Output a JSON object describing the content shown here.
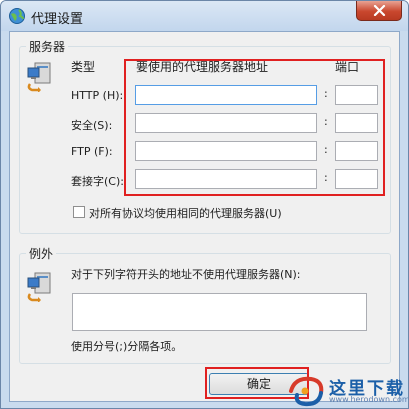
{
  "window": {
    "title": "代理设置",
    "accent": "#c9dbee",
    "close_color": "#c9472e"
  },
  "servers": {
    "group_title": "服务器",
    "type_header": "类型",
    "address_header": "要使用的代理服务器地址",
    "port_header": "端口",
    "rows": [
      {
        "label": "HTTP (H):",
        "address": "",
        "port": ""
      },
      {
        "label": "安全(S):",
        "address": "",
        "port": ""
      },
      {
        "label": "FTP (F):",
        "address": "",
        "port": ""
      },
      {
        "label": "套接字(C):",
        "address": "",
        "port": ""
      }
    ],
    "colon": ":",
    "same_proxy_label": "对所有协议均使用相同的代理服务器(U)",
    "same_proxy_checked": false,
    "highlight_color": "#e02020"
  },
  "exceptions": {
    "group_title": "例外",
    "description": "对于下列字符开头的地址不使用代理服务器(N):",
    "value": "",
    "hint": "使用分号(;)分隔各项。"
  },
  "buttons": {
    "ok": "确定"
  },
  "watermark": {
    "text": "这里下载",
    "url": "www.herodown.com"
  },
  "icons": {
    "app": "network-globe-icon",
    "computer": "computer-icon",
    "close": "close-icon"
  }
}
